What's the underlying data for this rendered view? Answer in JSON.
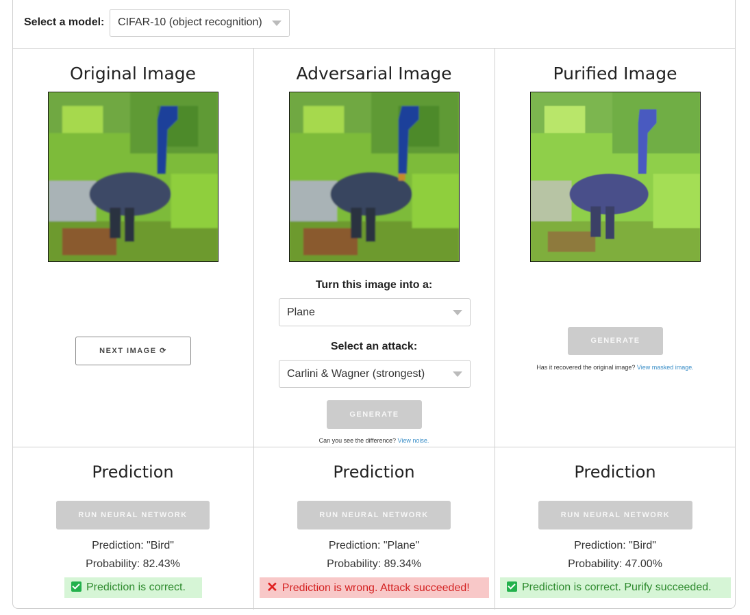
{
  "model": {
    "label": "Select a model:",
    "selected": "CIFAR-10 (object recognition)"
  },
  "columns": {
    "original": {
      "title": "Original Image",
      "next_button": "NEXT IMAGE ⟳"
    },
    "adversarial": {
      "title": "Adversarial Image",
      "target_label": "Turn this image into a:",
      "target_selected": "Plane",
      "attack_label": "Select an attack:",
      "attack_selected": "Carlini & Wagner (strongest)",
      "generate_button": "GENERATE",
      "note_text": "Can you see the difference?",
      "note_link": "View noise."
    },
    "purified": {
      "title": "Purified Image",
      "generate_button": "GENERATE",
      "note_text": "Has it recovered the original image?",
      "note_link": "View masked image."
    }
  },
  "predictions": [
    {
      "title": "Prediction",
      "button": "RUN NEURAL NETWORK",
      "prediction": "Prediction: \"Bird\"",
      "probability": "Probability: 82.43%",
      "status": "Prediction is correct.",
      "status_type": "ok"
    },
    {
      "title": "Prediction",
      "button": "RUN NEURAL NETWORK",
      "prediction": "Prediction: \"Plane\"",
      "probability": "Probability: 89.34%",
      "status": "Prediction is wrong. Attack succeeded!",
      "status_type": "bad"
    },
    {
      "title": "Prediction",
      "button": "RUN NEURAL NETWORK",
      "prediction": "Prediction: \"Bird\"",
      "probability": "Probability: 47.00%",
      "status": "Prediction is correct. Purify succeeded.",
      "status_type": "ok"
    }
  ],
  "colors": {
    "status_ok_bg": "#d6f5d6",
    "status_ok_text": "#2d8a2d",
    "status_bad_bg": "#f8c8c8",
    "status_bad_text": "#d42222",
    "disabled_button": "#cccccc",
    "link": "#3a8ec7"
  }
}
